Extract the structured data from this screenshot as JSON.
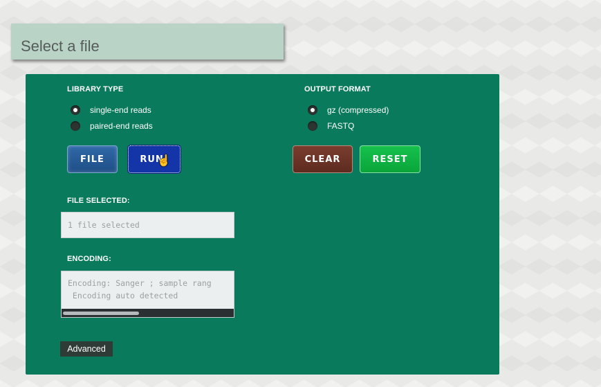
{
  "header": {
    "title": "Select a file"
  },
  "library_type": {
    "label": "LIBRARY TYPE",
    "options": [
      {
        "label": "single-end reads",
        "checked": true
      },
      {
        "label": "paired-end reads",
        "checked": false
      }
    ]
  },
  "output_format": {
    "label": "OUTPUT FORMAT",
    "options": [
      {
        "label": "gz (compressed)",
        "checked": true
      },
      {
        "label": "FASTQ",
        "checked": false
      }
    ]
  },
  "buttons": {
    "file": "FILE",
    "run": "RUN!",
    "clear": "CLEAR",
    "reset": "RESET",
    "advanced": "Advanced"
  },
  "file_selected": {
    "label": "FILE SELECTED:",
    "value": "1 file selected"
  },
  "encoding": {
    "label": "ENCODING:",
    "line1": "Encoding: Sanger ; sample rang",
    "line2": " Encoding auto detected"
  },
  "colors": {
    "panel": "#0a7a5c",
    "header": "#b9d4c7",
    "file_button": "#2f68a8",
    "run_button": "#1335a8",
    "clear_button": "#7a3d2e",
    "reset_button": "#16c14c"
  },
  "icons": {
    "cursor": "hand-pointer-icon"
  }
}
